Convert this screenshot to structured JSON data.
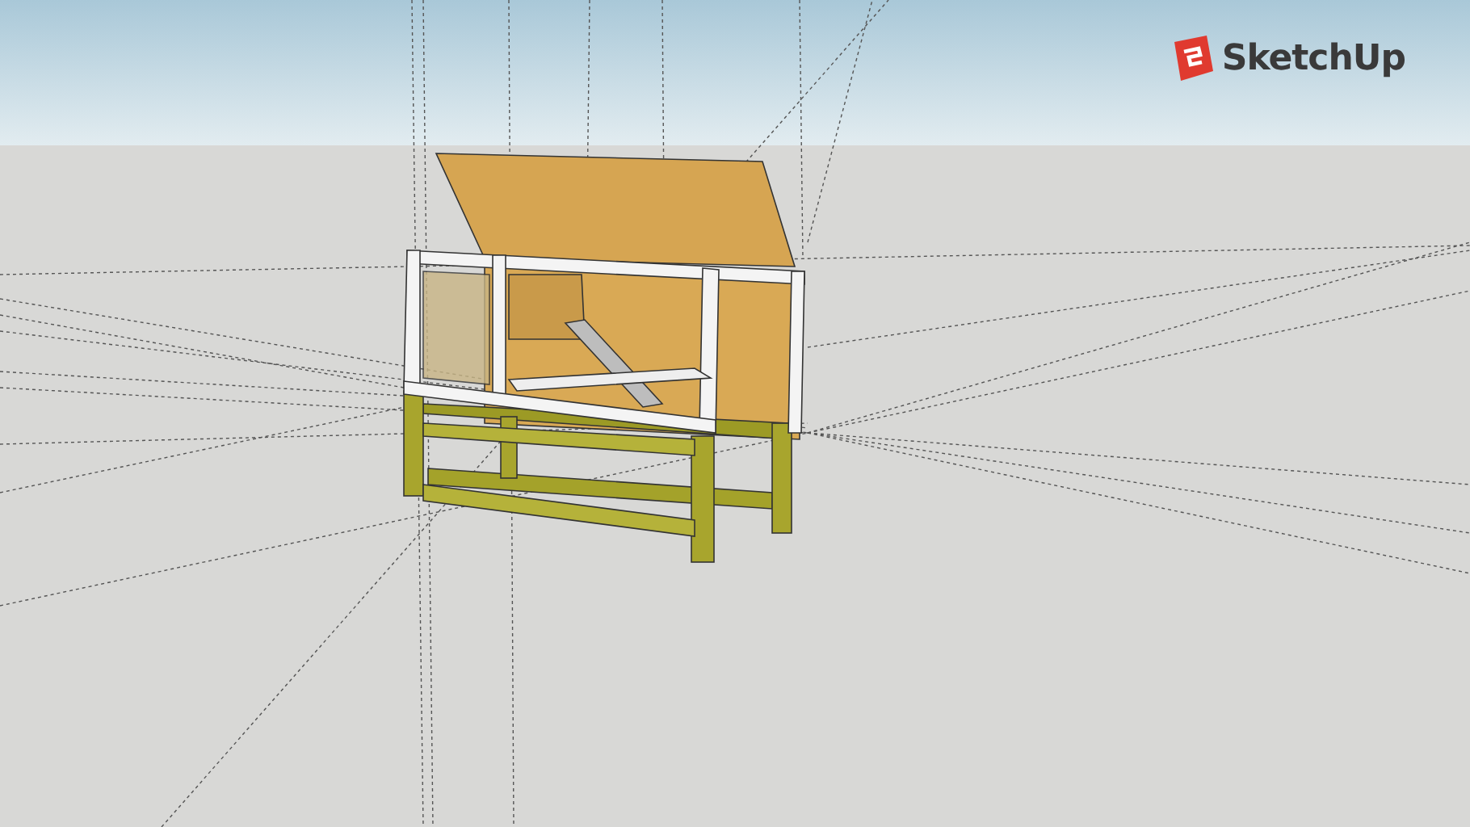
{
  "logo": {
    "text": "SketchUp"
  }
}
